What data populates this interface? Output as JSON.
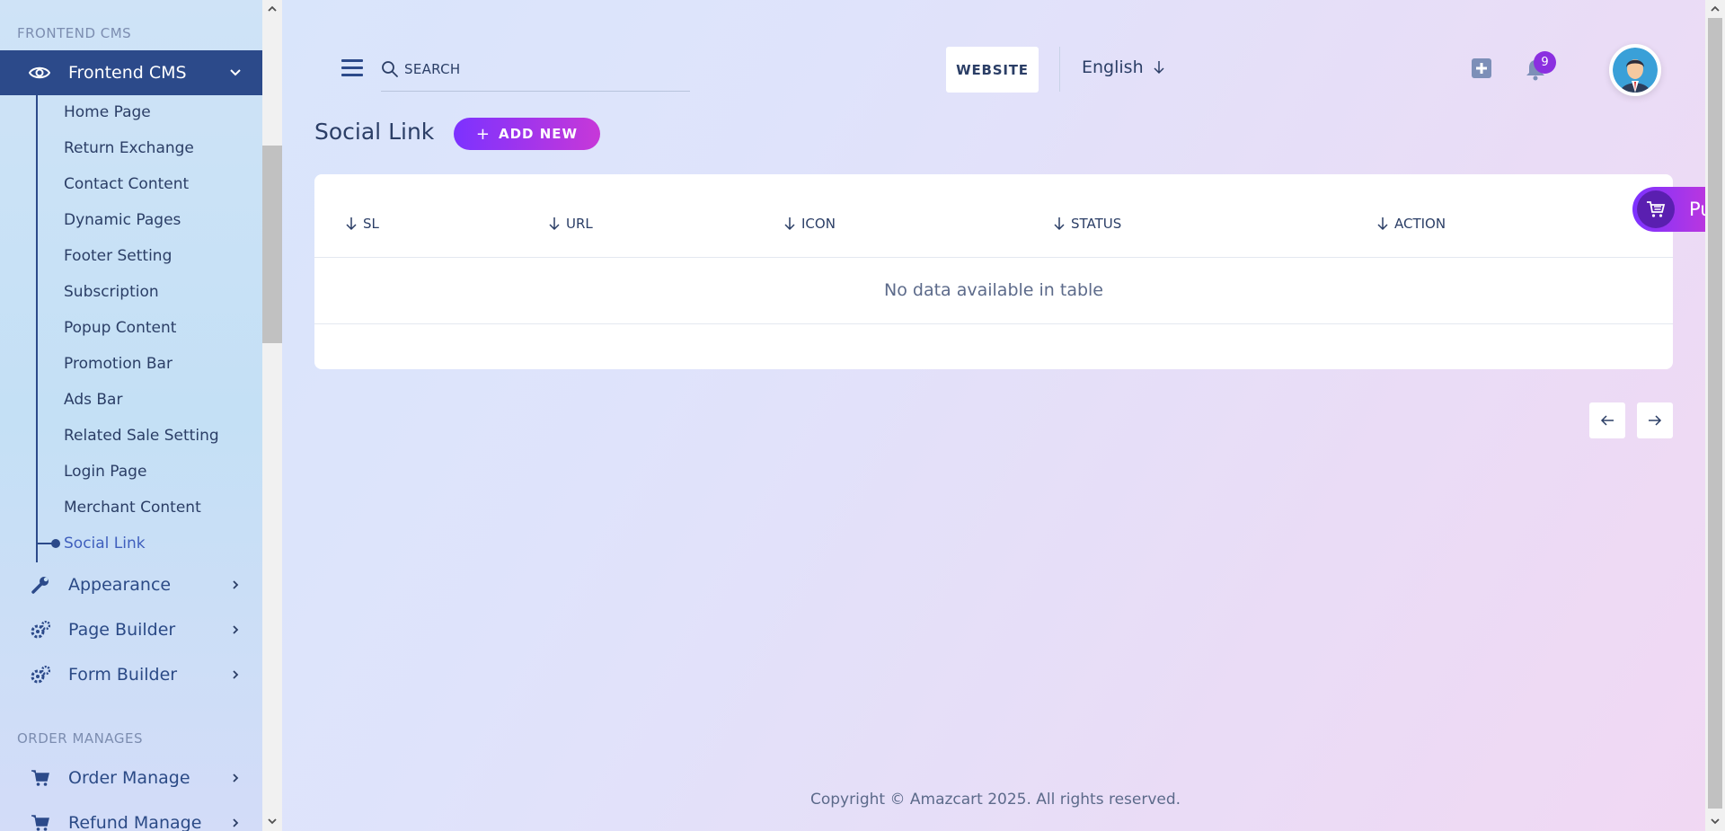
{
  "sidebar": {
    "section_frontend": "FRONTEND CMS",
    "active_menu": "Frontend CMS",
    "submenu": [
      "Home Page",
      "Return Exchange",
      "Contact Content",
      "Dynamic Pages",
      "Footer Setting",
      "Subscription",
      "Popup Content",
      "Promotion Bar",
      "Ads Bar",
      "Related Sale Setting",
      "Login Page",
      "Merchant Content",
      "Social Link"
    ],
    "menus": [
      "Appearance",
      "Page Builder",
      "Form Builder"
    ],
    "section_order": "ORDER MANAGES",
    "order_menus": [
      "Order Manage",
      "Refund Manage"
    ]
  },
  "header": {
    "search_placeholder": "SEARCH",
    "website_label": "WEBSITE",
    "language": "English",
    "notification_count": "9"
  },
  "main": {
    "title": "Social Link",
    "add_new_label": "ADD NEW",
    "table": {
      "columns": [
        "SL",
        "URL",
        "ICON",
        "STATUS",
        "ACTION"
      ],
      "empty_message": "No data available in table"
    },
    "purchase_label": "Pu"
  },
  "footer": {
    "copyright": "Copyright © Amazcart 2025. All rights reserved."
  },
  "colors": {
    "sidebar_active": "#2c4a8a",
    "accent_start": "#7c32ff",
    "accent_end": "#c738d8",
    "badge": "#8b2fe0"
  }
}
